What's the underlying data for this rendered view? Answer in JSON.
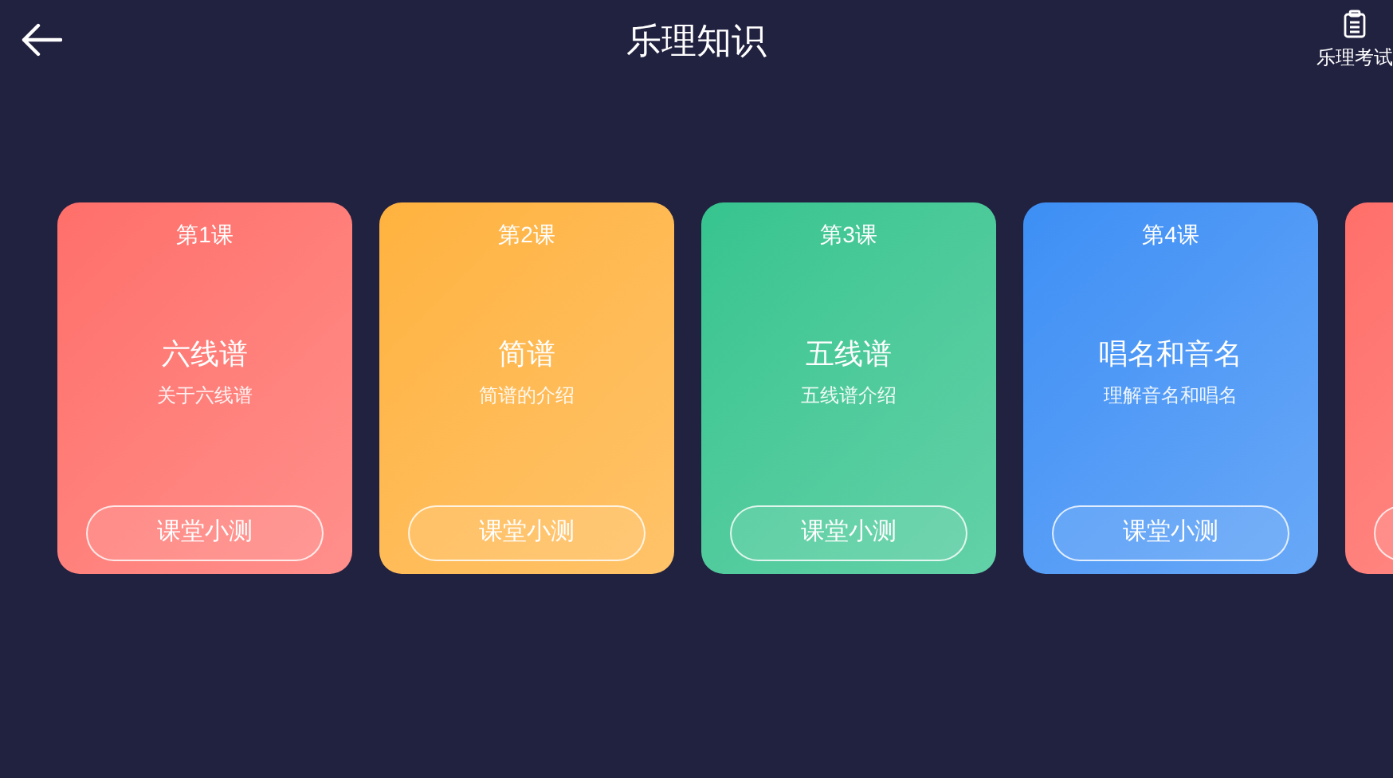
{
  "header": {
    "title": "乐理知识",
    "exam_label": "乐理考试"
  },
  "lessons": [
    {
      "color": "#ff6f6a",
      "number": "第1课",
      "title": "六线谱",
      "subtitle": "关于六线谱",
      "button": "课堂小测"
    },
    {
      "color": "#ffb23e",
      "number": "第2课",
      "title": "简谱",
      "subtitle": "简谱的介绍",
      "button": "课堂小测"
    },
    {
      "color": "#36c48f",
      "number": "第3课",
      "title": "五线谱",
      "subtitle": "五线谱介绍",
      "button": "课堂小测"
    },
    {
      "color": "#3d8ff5",
      "number": "第4课",
      "title": "唱名和音名",
      "subtitle": "理解音名和唱名",
      "button": "课堂小测"
    },
    {
      "color": "#ff6f6a"
    }
  ]
}
